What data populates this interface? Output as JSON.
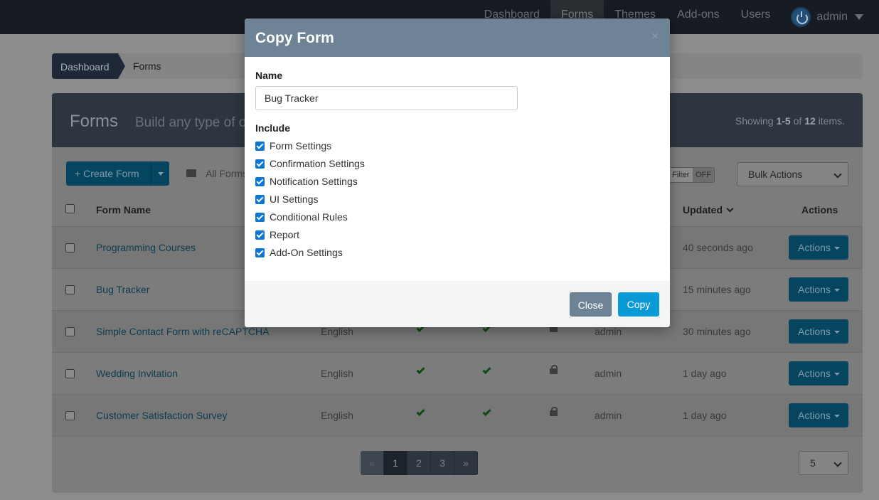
{
  "navbar": {
    "links": [
      "Dashboard",
      "Forms",
      "Themes",
      "Add-ons",
      "Users"
    ],
    "user": "admin"
  },
  "breadcrumb": {
    "home": "Dashboard",
    "current": "Forms"
  },
  "panel": {
    "title": "Forms",
    "subtitle": "Build any type of o",
    "count_prefix": "Showing ",
    "count_range": "1-5",
    "count_mid": " of ",
    "count_total": "12",
    "count_suffix": " items."
  },
  "toolbar": {
    "create_label": "Create Form",
    "all_forms": "All Forms",
    "filter_label": "Filter",
    "filter_state": "OFF",
    "bulk_actions": "Bulk Actions"
  },
  "table": {
    "headers": {
      "name": "Form Name",
      "updated": "Updated",
      "actions": "Actions"
    },
    "rows": [
      {
        "name": "Programming Courses",
        "language": "",
        "owner": "",
        "updated": "40 seconds ago",
        "actions": "Actions"
      },
      {
        "name": "Bug Tracker",
        "language": "",
        "owner": "",
        "updated": "15 minutes ago",
        "actions": "Actions"
      },
      {
        "name": "Simple Contact Form with reCAPTCHA",
        "language": "English",
        "owner": "admin",
        "updated": "30 minutes ago",
        "actions": "Actions"
      },
      {
        "name": "Wedding Invitation",
        "language": "English",
        "owner": "admin",
        "updated": "1 day ago",
        "actions": "Actions"
      },
      {
        "name": "Customer Satisfaction Survey",
        "language": "English",
        "owner": "admin",
        "updated": "1 day ago",
        "actions": "Actions"
      }
    ]
  },
  "pagination": {
    "prev": "«",
    "pages": [
      "1",
      "2",
      "3"
    ],
    "next": "»",
    "current": "1",
    "page_size": "5"
  },
  "modal": {
    "title": "Copy Form",
    "close_icon": "×",
    "name_label": "Name",
    "name_value": "Bug Tracker",
    "include_label": "Include",
    "options": [
      {
        "label": "Form Settings",
        "checked": true
      },
      {
        "label": "Confirmation Settings",
        "checked": true
      },
      {
        "label": "Notification Settings",
        "checked": true
      },
      {
        "label": "UI Settings",
        "checked": true
      },
      {
        "label": "Conditional Rules",
        "checked": true
      },
      {
        "label": "Report",
        "checked": true
      },
      {
        "label": "Add-On Settings",
        "checked": true
      }
    ],
    "close_button": "Close",
    "copy_button": "Copy"
  },
  "colors": {
    "modal_header": "#6e8496",
    "primary": "#0b9ad8",
    "checkbox": "#0b75d8",
    "navbar": "#171b22"
  }
}
